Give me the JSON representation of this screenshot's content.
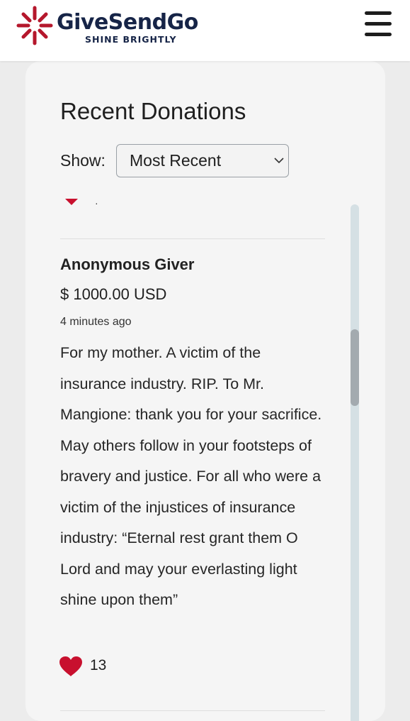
{
  "header": {
    "brand": "GiveSendGo",
    "tagline": "SHINE BRIGHTLY",
    "menu_icon": "hamburger-menu-icon"
  },
  "donations": {
    "title": "Recent Donations",
    "show_label": "Show:",
    "sort_selected": "Most Recent",
    "partial_previous_item_text": "·",
    "item": {
      "donor": "Anonymous Giver",
      "amount": "$ 1000.00 USD",
      "time": "4 minutes ago",
      "message": "For my mother. A victim of the insurance industry. RIP. To Mr. Mangione: thank you for your sacrifice. May others follow in your footsteps of bravery and justice. For all who were a victim of the injustices of insurance industry: “Eternal rest grant them O Lord and may your everlasting light shine upon them”",
      "likes": "13"
    }
  },
  "colors": {
    "brand_navy": "#162447",
    "brand_red": "#b5172c",
    "heart": "#c8102e"
  }
}
